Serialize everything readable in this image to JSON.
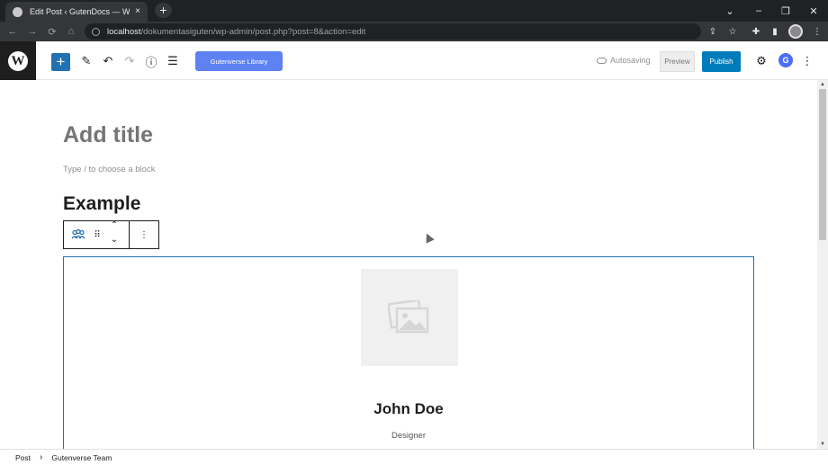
{
  "browser": {
    "tab_title": "Edit Post ‹ GutenDocs — WordPress",
    "tab_close": "×",
    "new_tab": "+",
    "url_host": "localhost",
    "url_path": "/dokumentasiguten/wp-admin/post.php?post=8&action=edit",
    "window_controls": {
      "tabs_menu": "⌄",
      "minimize": "–",
      "restore": "❐",
      "close": "✕"
    },
    "nav": {
      "back": "←",
      "forward": "→",
      "reload": "⟳",
      "home": "⌂"
    },
    "toolbar_icons": {
      "share": "⇪",
      "bookmark": "☆",
      "extensions": "✚",
      "sidebar": "▮",
      "menu": "⋮"
    }
  },
  "editor_header": {
    "logo_glyph": "W",
    "add_block": "+",
    "tools_glyph": "✎",
    "undo_glyph": "↶",
    "redo_glyph": "↷",
    "details_glyph": "ⓘ",
    "list_view_glyph": "☰",
    "library_button": "Gutenverse Library",
    "autosave_status": "Autosaving",
    "preview_button": "Preview",
    "publish_button": "Publish",
    "settings_glyph": "⚙",
    "plugin_glyph": "G",
    "options_glyph": "⋮"
  },
  "content": {
    "title_placeholder": "Add title",
    "block_placeholder": "Type / to choose a block",
    "heading": "Example",
    "block_toolbar": {
      "move_glyph": "⠿",
      "up_glyph": "⌃",
      "down_glyph": "⌄",
      "options_glyph": "⋮"
    },
    "team_member": {
      "name": "John Doe",
      "job": "Designer"
    }
  },
  "breadcrumb": {
    "items": [
      "Post",
      "Gutenverse Team"
    ],
    "separator": "›"
  },
  "colors": {
    "accent": "#2271b1",
    "library_button": "#5e81f4",
    "publish": "#007cba"
  },
  "icons": [
    "wordpress-icon",
    "plus-icon",
    "pencil-icon",
    "undo-icon",
    "redo-icon",
    "info-icon",
    "list-view-icon",
    "cloud-icon",
    "gear-icon",
    "team-block-icon",
    "drag-handle-icon",
    "image-placeholder-icon"
  ]
}
